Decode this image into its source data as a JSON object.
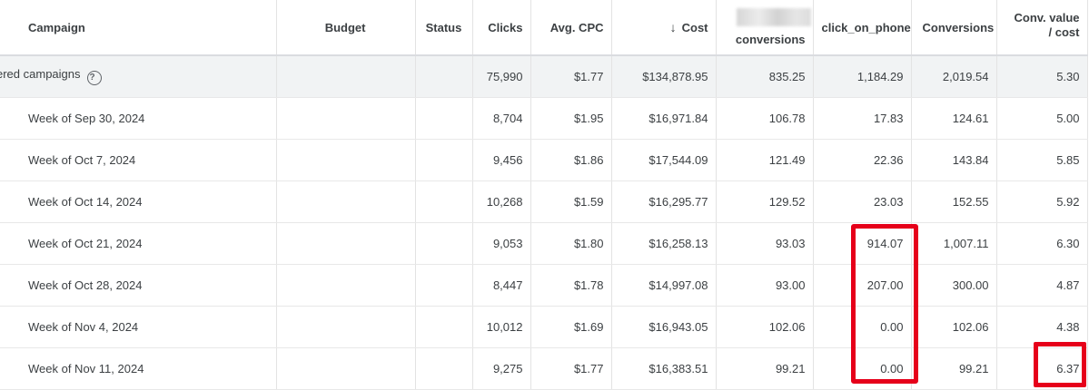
{
  "columns": {
    "campaign": "Campaign",
    "budget": "Budget",
    "status": "Status",
    "clicks": "Clicks",
    "avg_cpc": "Avg. CPC",
    "cost": "Cost",
    "cost_sort_icon": "arrow-down-icon",
    "blurred_conversions": "conversions",
    "click_on_phone": "click_on_phone",
    "conversions": "Conversions",
    "conv_value_cost_line1": "Conv. value",
    "conv_value_cost_line2": "/ cost"
  },
  "total": {
    "label": "ered campaigns",
    "help_icon": "?",
    "budget": "",
    "status": "",
    "clicks": "75,990",
    "avg_cpc": "$1.77",
    "cost": "$134,878.95",
    "blurred_conversions": "835.25",
    "click_on_phone": "1,184.29",
    "conversions": "2,019.54",
    "conv_value_cost": "5.30"
  },
  "rows": [
    {
      "week": "Week of Sep 30, 2024",
      "clicks": "8,704",
      "avg_cpc": "$1.95",
      "cost": "$16,971.84",
      "blurred_conversions": "106.78",
      "click_on_phone": "17.83",
      "conversions": "124.61",
      "conv_value_cost": "5.00"
    },
    {
      "week": "Week of Oct 7, 2024",
      "clicks": "9,456",
      "avg_cpc": "$1.86",
      "cost": "$17,544.09",
      "blurred_conversions": "121.49",
      "click_on_phone": "22.36",
      "conversions": "143.84",
      "conv_value_cost": "5.85"
    },
    {
      "week": "Week of Oct 14, 2024",
      "clicks": "10,268",
      "avg_cpc": "$1.59",
      "cost": "$16,295.77",
      "blurred_conversions": "129.52",
      "click_on_phone": "23.03",
      "conversions": "152.55",
      "conv_value_cost": "5.92"
    },
    {
      "week": "Week of Oct 21, 2024",
      "clicks": "9,053",
      "avg_cpc": "$1.80",
      "cost": "$16,258.13",
      "blurred_conversions": "93.03",
      "click_on_phone": "914.07",
      "conversions": "1,007.11",
      "conv_value_cost": "6.30"
    },
    {
      "week": "Week of Oct 28, 2024",
      "clicks": "8,447",
      "avg_cpc": "$1.78",
      "cost": "$14,997.08",
      "blurred_conversions": "93.00",
      "click_on_phone": "207.00",
      "conversions": "300.00",
      "conv_value_cost": "4.87"
    },
    {
      "week": "Week of Nov 4, 2024",
      "clicks": "10,012",
      "avg_cpc": "$1.69",
      "cost": "$16,943.05",
      "blurred_conversions": "102.06",
      "click_on_phone": "0.00",
      "conversions": "102.06",
      "conv_value_cost": "4.38"
    },
    {
      "week": "Week of Nov 11, 2024",
      "clicks": "9,275",
      "avg_cpc": "$1.77",
      "cost": "$16,383.51",
      "blurred_conversions": "99.21",
      "click_on_phone": "0.00",
      "conversions": "99.21",
      "conv_value_cost": "6.37"
    }
  ],
  "annotation_color": "#e6001a"
}
